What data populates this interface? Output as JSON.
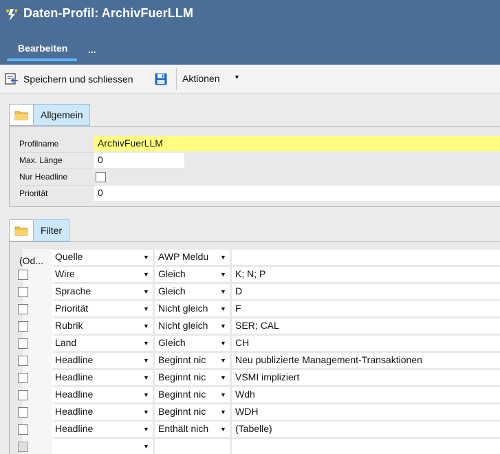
{
  "header": {
    "title": "Daten-Profil: ArchivFuerLLM",
    "tab_active": "Bearbeiten",
    "tab_more": "..."
  },
  "toolbar": {
    "save_close_label": "Speichern und schliessen",
    "actions_label": "Aktionen",
    "actions_caret": "▼"
  },
  "allgemein": {
    "tab_label": "Allgemein",
    "fields": [
      {
        "label": "Profilname",
        "value": "ArchivFuerLLM"
      },
      {
        "label": "Max. Länge",
        "value": "0"
      },
      {
        "label": "Nur Headline",
        "value": ""
      },
      {
        "label": "Priorität",
        "value": "0"
      }
    ]
  },
  "filter": {
    "tab_label": "Filter",
    "header_left": "(Od...",
    "rows": [
      {
        "field": "Quelle",
        "op": "AWP Meldu",
        "value": ""
      },
      {
        "field": "Wire",
        "op": "Gleich",
        "value": "K; N; P"
      },
      {
        "field": "Sprache",
        "op": "Gleich",
        "value": "D"
      },
      {
        "field": "Priorität",
        "op": "Nicht gleich",
        "value": "F"
      },
      {
        "field": "Rubrik",
        "op": "Nicht gleich",
        "value": "SER; CAL"
      },
      {
        "field": "Land",
        "op": "Gleich",
        "value": "CH"
      },
      {
        "field": "Headline",
        "op": "Beginnt nic",
        "value": "Neu publizierte Management-Transaktionen"
      },
      {
        "field": "Headline",
        "op": "Beginnt nic",
        "value": "VSMI impliziert"
      },
      {
        "field": "Headline",
        "op": "Beginnt nic",
        "value": "Wdh"
      },
      {
        "field": "Headline",
        "op": "Beginnt nic",
        "value": "WDH"
      },
      {
        "field": "Headline",
        "op": "Enthält nich",
        "value": "(Tabelle)"
      },
      {
        "field": "",
        "op": "",
        "value": ""
      }
    ]
  },
  "colors": {
    "header_bg": "#4a6e96",
    "tab_underline": "#5fb8ff",
    "profilname_highlight": "#ffff80",
    "section_tab_bg": "#cde8fa"
  }
}
